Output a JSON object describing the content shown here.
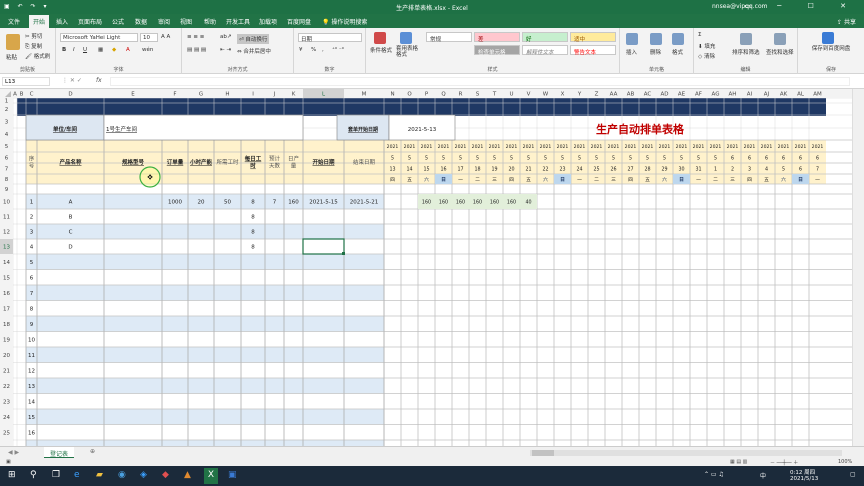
{
  "window": {
    "title": "生产排单表格.xlsx - Excel",
    "user": "nnsea@vipqq.com",
    "share": "共享"
  },
  "tabs": [
    "文件",
    "开始",
    "插入",
    "页面布局",
    "公式",
    "数据",
    "审阅",
    "视图",
    "帮助",
    "开发工具",
    "加载项",
    "百度网盘",
    "操作说明搜索"
  ],
  "active_tab_index": 1,
  "ribbon": {
    "clipboard": {
      "label": "剪贴板",
      "paste": "粘贴",
      "cut": "剪切",
      "copy": "复制",
      "painter": "格式刷"
    },
    "font": {
      "label": "字体",
      "name": "Microsoft YaHei Light",
      "size": "10",
      "bold": "B",
      "italic": "I",
      "underline": "U",
      "wen": "wén"
    },
    "alignment": {
      "label": "对齐方式",
      "wrap": "自动换行",
      "merge": "合并后居中"
    },
    "number": {
      "label": "数字",
      "format": "日期",
      "percent": "%",
      "comma": ","
    },
    "styles": {
      "label": "样式",
      "cond": "条件格式",
      "table": "套用表格格式",
      "items": [
        {
          "text": "常规",
          "bg": "#ffffff",
          "fg": "#333333"
        },
        {
          "text": "差",
          "bg": "#ffc7ce",
          "fg": "#9c0006"
        },
        {
          "text": "好",
          "bg": "#c6efce",
          "fg": "#006100"
        },
        {
          "text": "适中",
          "bg": "#ffeb9c",
          "fg": "#9c5700"
        },
        {
          "text": "检查单元格",
          "bg": "#a5a5a5",
          "fg": "#ffffff"
        },
        {
          "text": "解释性文本",
          "bg": "#ffffff",
          "fg": "#7f7f7f"
        },
        {
          "text": "警告文本",
          "bg": "#ffffff",
          "fg": "#ff0000"
        },
        {
          "text": "链接单元格",
          "bg": "#ffffff",
          "fg": "#fa7d00"
        }
      ]
    },
    "cells": {
      "label": "单元格",
      "insert": "插入",
      "delete": "删除",
      "format": "格式"
    },
    "editing": {
      "label": "编辑",
      "sum": "Σ",
      "fill": "填充",
      "clear": "清除",
      "sort": "排序和筛选",
      "find": "查找和选择"
    },
    "save": {
      "label": "保存",
      "baidu": "保存到百度网盘"
    }
  },
  "formula_bar": {
    "name_box": "L13",
    "fx": "fx",
    "value": ""
  },
  "colors": {
    "excel_green": "#217346",
    "header_yellow": "#fff2cc",
    "stripe_blue": "#deeaf6",
    "day_green": "#e2efda",
    "title_red": "#c00000",
    "selection": "#1e7145"
  },
  "columns": [
    "A",
    "B",
    "C",
    "D",
    "E",
    "F",
    "G",
    "H",
    "I",
    "J",
    "K",
    "L",
    "M",
    "N",
    "O",
    "P",
    "Q",
    "R",
    "S",
    "T",
    "U",
    "V",
    "W",
    "X",
    "Y",
    "Z",
    "AA",
    "AB",
    "AC",
    "AD",
    "AE",
    "AF",
    "AG",
    "AH",
    "AI",
    "AJ",
    "AK",
    "AL",
    "AM"
  ],
  "rows": [
    "1",
    "2",
    "3",
    "4",
    "5",
    "6",
    "7",
    "8",
    "9",
    "10",
    "11",
    "12",
    "13",
    "14",
    "15",
    "16",
    "17",
    "18",
    "19",
    "20",
    "21",
    "22",
    "23",
    "24",
    "25",
    "26"
  ],
  "sheet": {
    "unit_label": "单位/车间",
    "unit_value": "1号生产车间",
    "start_label": "套单开始日期",
    "start_value": "2021-5-13",
    "main_title": "生产自动排单表格",
    "headers": {
      "seq": "序号",
      "product": "产品名称",
      "spec": "规格型号",
      "order": "订单量",
      "hour_cap": "小时产能",
      "hours_needed": "所需工时",
      "daily_hours": "每日工时",
      "est_days": "预计天数",
      "daily_out": "日产量",
      "start_date": "开始日期",
      "end_date": "结束日期"
    },
    "year": "2021",
    "months": [
      "5",
      "5",
      "5",
      "5",
      "5",
      "5",
      "5",
      "5",
      "5",
      "5",
      "5",
      "5",
      "5",
      "5",
      "5",
      "5",
      "5",
      "5",
      "5",
      "5",
      "6",
      "6",
      "6",
      "6",
      "6",
      "6",
      "6",
      "6"
    ],
    "days": [
      "13",
      "14",
      "15",
      "16",
      "17",
      "18",
      "19",
      "20",
      "21",
      "22",
      "23",
      "24",
      "25",
      "26",
      "27",
      "28",
      "29",
      "30",
      "31",
      "1",
      "2",
      "3",
      "4",
      "5",
      "6",
      "7",
      "8",
      "9"
    ],
    "weekdays": [
      "四",
      "五",
      "六",
      "日",
      "一",
      "二",
      "三",
      "四",
      "五",
      "六",
      "日",
      "一",
      "二",
      "三",
      "四",
      "五",
      "六",
      "日",
      "一",
      "二",
      "三",
      "四",
      "五",
      "六",
      "日",
      "一",
      "二",
      "三"
    ],
    "schedule_values": [
      "160",
      "160",
      "160",
      "160",
      "160",
      "160",
      "40"
    ],
    "records": [
      {
        "seq": "1",
        "product": "A",
        "spec": "",
        "order": "1000",
        "hour_cap": "20",
        "hours_needed": "50",
        "daily_hours": "8",
        "est_days": "7",
        "daily_out": "160",
        "start_date": "2021-5-15",
        "end_date": "2021-5-21"
      },
      {
        "seq": "2",
        "product": "B",
        "spec": "",
        "order": "",
        "hour_cap": "",
        "hours_needed": "",
        "daily_hours": "8",
        "est_days": "",
        "daily_out": "",
        "start_date": "",
        "end_date": ""
      },
      {
        "seq": "3",
        "product": "C",
        "spec": "",
        "order": "",
        "hour_cap": "",
        "hours_needed": "",
        "daily_hours": "8",
        "est_days": "",
        "daily_out": "",
        "start_date": "",
        "end_date": ""
      },
      {
        "seq": "4",
        "product": "D",
        "spec": "",
        "order": "",
        "hour_cap": "",
        "hours_needed": "",
        "daily_hours": "8",
        "est_days": "",
        "daily_out": "",
        "start_date": "",
        "end_date": ""
      }
    ],
    "empty_seq": [
      "5",
      "6",
      "7",
      "8",
      "9",
      "10",
      "11",
      "12",
      "13",
      "14",
      "15",
      "16",
      "17"
    ]
  },
  "sheet_tab": "登记表",
  "status": {
    "zoom": "100%"
  },
  "taskbar": {
    "time": "0:12 周四",
    "date": "2021/5/13",
    "lang": "中"
  }
}
